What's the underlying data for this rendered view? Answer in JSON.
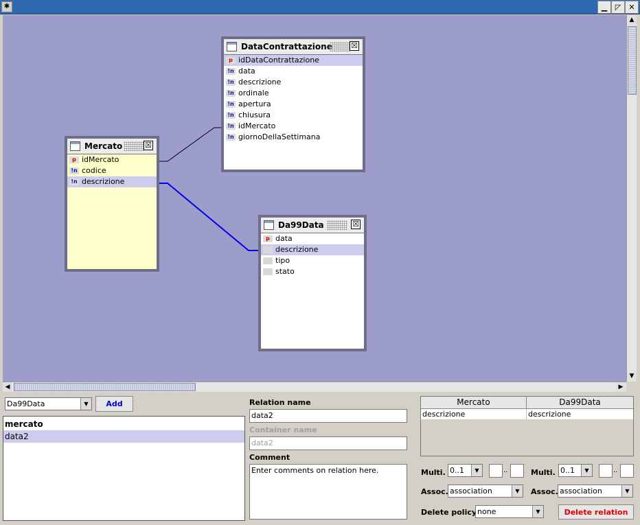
{
  "window": {
    "pin_glyph": "✱",
    "minimize_glyph": "▁",
    "maximize_glyph": "◸",
    "close_glyph": "✕"
  },
  "scrollbars": {
    "up": "▲",
    "down": "▼",
    "left": "◀",
    "right": "▶"
  },
  "entities": {
    "mercato": {
      "title": "Mercato",
      "close": "☒",
      "fields": [
        {
          "icon": "p",
          "name": "idMercato",
          "selected": false
        },
        {
          "icon": "!n",
          "name": "codice",
          "selected": false
        },
        {
          "icon": "!n",
          "name": "descrizione",
          "selected": true
        }
      ]
    },
    "dataContrattazione": {
      "title": "DataContrattazione",
      "close": "☒",
      "fields": [
        {
          "icon": "p",
          "name": "idDataContrattazione",
          "selected": true
        },
        {
          "icon": "!n",
          "name": "data",
          "selected": false
        },
        {
          "icon": "!n",
          "name": "descrizione",
          "selected": false
        },
        {
          "icon": "!n",
          "name": "ordinale",
          "selected": false
        },
        {
          "icon": "!n",
          "name": "apertura",
          "selected": false
        },
        {
          "icon": "!n",
          "name": "chiusura",
          "selected": false
        },
        {
          "icon": "!n",
          "name": "idMercato",
          "selected": false
        },
        {
          "icon": "!n",
          "name": "giornoDellaSettimana",
          "selected": false
        }
      ]
    },
    "da99Data": {
      "title": "Da99Data",
      "close": "☒",
      "fields": [
        {
          "icon": "p",
          "name": "data",
          "selected": false
        },
        {
          "icon": "",
          "name": "descrizione",
          "selected": true
        },
        {
          "icon": "",
          "name": "tipo",
          "selected": false
        },
        {
          "icon": "",
          "name": "stato",
          "selected": false
        }
      ]
    }
  },
  "relations_panel": {
    "target_select": "Da99Data",
    "add_label": "Add",
    "relations": [
      {
        "name": "mercato",
        "selected": false
      },
      {
        "name": "data2",
        "selected": true
      }
    ]
  },
  "relation_editor": {
    "relation_name_label": "Relation name",
    "relation_name_value": "data2",
    "container_name_label": "Container name",
    "container_name_value": "data2",
    "comment_label": "Comment",
    "comment_value": "Enter comments on relation here."
  },
  "mapping_table": {
    "headers": [
      "Mercato",
      "Da99Data"
    ],
    "rows": [
      [
        "descrizione",
        "descrizione"
      ]
    ]
  },
  "multiplicity": {
    "label": "Multi.",
    "left_value": "0..1",
    "right_value": "0..1",
    "dots": ".."
  },
  "association": {
    "label": "Assoc.",
    "left_value": "association",
    "right_value": "association"
  },
  "delete_policy": {
    "label": "Delete policy",
    "value": "none"
  },
  "delete_relation_label": "Delete relation",
  "colors": {
    "canvas": "#9d9dcc",
    "selected_row": "#ccccee",
    "delete_text": "#e00000",
    "add_text": "#0000c0",
    "relation_line_active": "#0000ee"
  }
}
